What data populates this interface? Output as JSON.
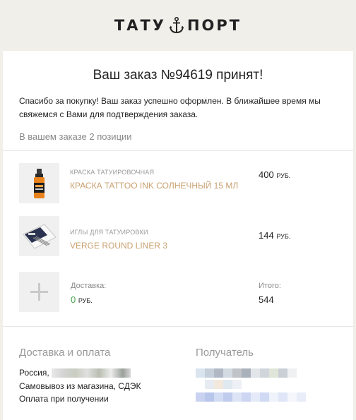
{
  "header": {
    "logo_left": "ТАТУ",
    "logo_right": "ПОРТ",
    "logo_icon": "anchor-icon"
  },
  "order": {
    "title": "Ваш заказ №94619 принят!",
    "intro": "Спасибо за покупку! Ваш заказ успешно оформлен. В ближайшее время мы свяжемся с Вами для подтверждения заказа.",
    "count_text": "В вашем заказе 2 позиции"
  },
  "items": [
    {
      "category": "Краска татуировочная",
      "name": "Краска TATTOO INK СОЛНЕЧНЫЙ 15 мл",
      "price": "400",
      "currency": "руб."
    },
    {
      "category": "Иглы для татуировки",
      "name": "VERGE ROUND LINER 3",
      "price": "144",
      "currency": "руб."
    }
  ],
  "summary": {
    "delivery_label": "Доставка:",
    "delivery_value": "0",
    "delivery_currency": "руб.",
    "total_label": "Итого:",
    "total_value": "544"
  },
  "delivery": {
    "title": "Доставка и оплата",
    "country": "Россия,",
    "method": "Самовывоз из магазина, СДЭК",
    "payment": "Оплата при получении"
  },
  "recipient": {
    "title": "Получатель"
  },
  "colors": {
    "background": "#f1efea",
    "accent": "#c9a070",
    "zero_green": "#47a54b"
  }
}
